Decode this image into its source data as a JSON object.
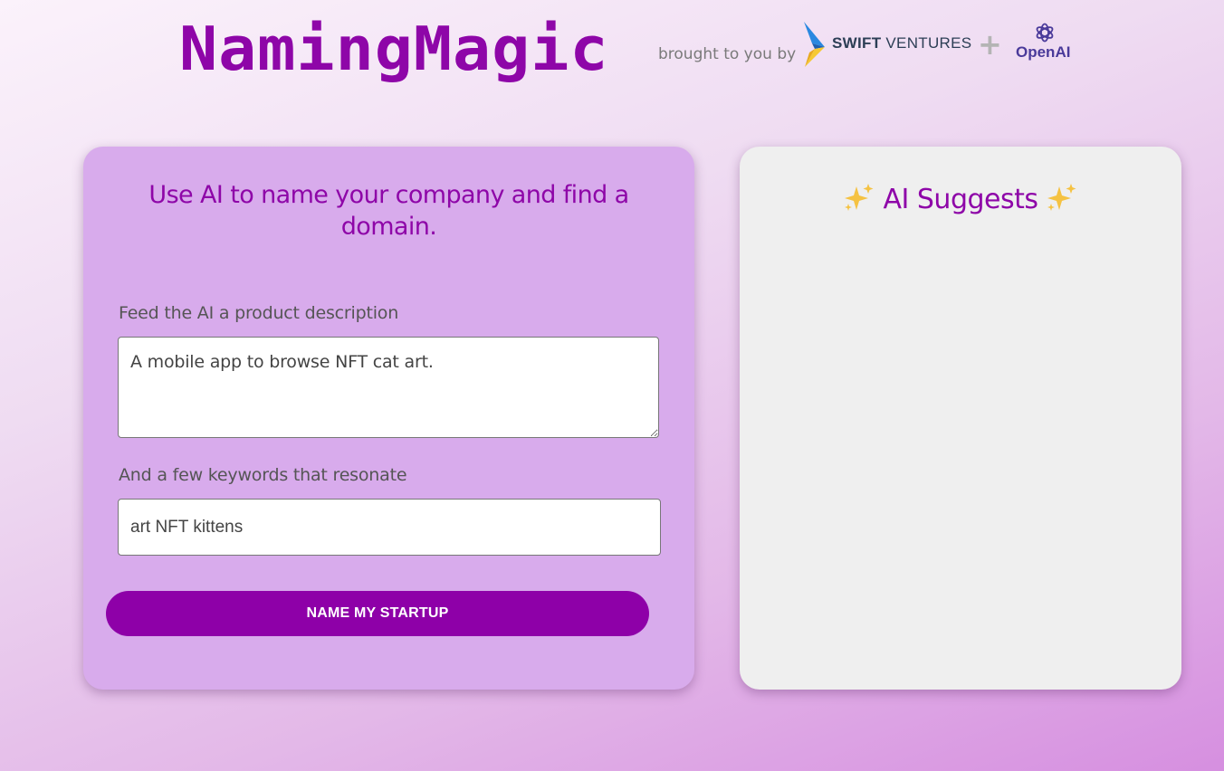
{
  "header": {
    "title": "NamingMagic",
    "brought_by": "brought to you by",
    "sponsor1_bold": "SWIFT",
    "sponsor1_rest": "VENTURES",
    "plus": "+",
    "sponsor2": "OpenAI"
  },
  "form": {
    "heading": "Use AI to name your company and find a domain.",
    "description_label": "Feed the AI a product description",
    "description_value": "A mobile app to browse NFT cat art.",
    "keywords_label": "And a few keywords that resonate",
    "keywords_value": "art NFT kittens",
    "submit_label": "NAME MY STARTUP"
  },
  "results": {
    "heading": "AI Suggests"
  },
  "colors": {
    "brand_purple": "#8e06a8",
    "button": "#8e00a8",
    "left_card": "#d8abec",
    "right_card": "#efefef",
    "sparkle": "#f5c242"
  },
  "icons": {
    "sparkle": "sparkle-icon",
    "swift_logo": "swift-ventures-logo",
    "openai_logo": "openai-logo"
  }
}
